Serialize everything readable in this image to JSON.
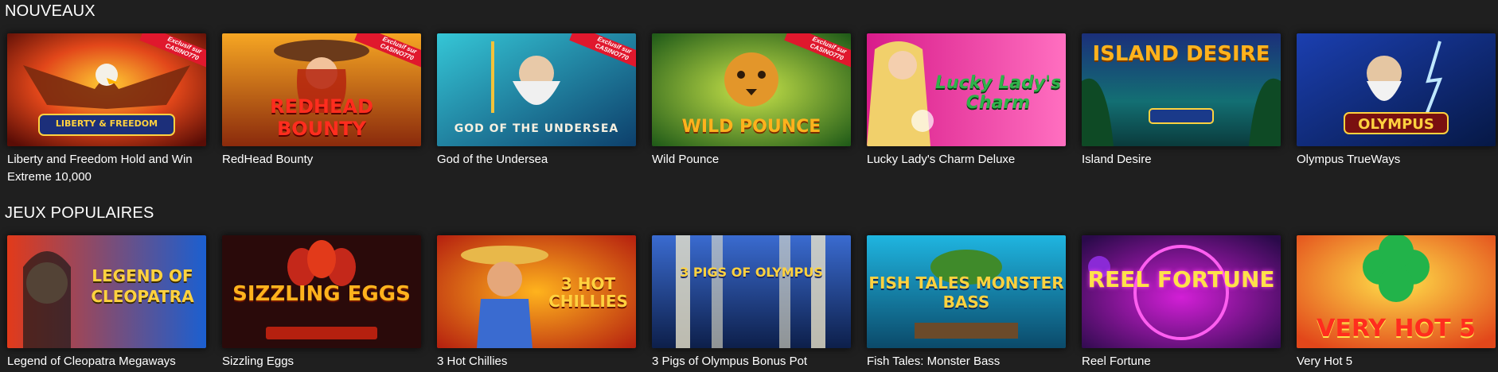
{
  "sections": [
    {
      "title": "NOUVEAUX",
      "games": [
        {
          "name": "Liberty and Freedom Hold and Win Extreme 10,000",
          "logo": "LIBERTY & FREEDOM",
          "exclusive": true
        },
        {
          "name": "RedHead Bounty",
          "logo": "REDHEAD BOUNTY",
          "exclusive": true
        },
        {
          "name": "God of the Undersea",
          "logo": "GOD OF THE UNDERSEA",
          "exclusive": true
        },
        {
          "name": "Wild Pounce",
          "logo": "WILD POUNCE",
          "exclusive": true
        },
        {
          "name": "Lucky Lady's Charm Deluxe",
          "logo": "Lucky Lady's Charm",
          "exclusive": false
        },
        {
          "name": "Island Desire",
          "logo": "ISLAND DESIRE",
          "exclusive": false
        },
        {
          "name": "Olympus TrueWays",
          "logo": "OLYMPUS",
          "exclusive": false
        }
      ]
    },
    {
      "title": "JEUX POPULAIRES",
      "games": [
        {
          "name": "Legend of Cleopatra Megaways",
          "logo": "LEGEND OF CLEOPATRA",
          "exclusive": false
        },
        {
          "name": "Sizzling Eggs",
          "logo": "SIZZLING EGGS",
          "exclusive": false
        },
        {
          "name": "3 Hot Chillies",
          "logo": "3 HOT CHILLIES",
          "exclusive": false
        },
        {
          "name": "3 Pigs of Olympus Bonus Pot",
          "logo": "3 PIGS OF OLYMPUS",
          "exclusive": false
        },
        {
          "name": "Fish Tales: Monster Bass",
          "logo": "FISH TALES MONSTER BASS",
          "exclusive": false
        },
        {
          "name": "Reel Fortune",
          "logo": "REEL FORTUNE",
          "exclusive": false
        },
        {
          "name": "Very Hot 5",
          "logo": "VERY HOT 5",
          "exclusive": false
        }
      ]
    }
  ],
  "ribbon": {
    "line1": "Exclusif sur",
    "line2": "CASINO770"
  },
  "colors": {
    "background": "#1f1f1f",
    "ribbon": "#e0182d",
    "text": "#ffffff"
  }
}
